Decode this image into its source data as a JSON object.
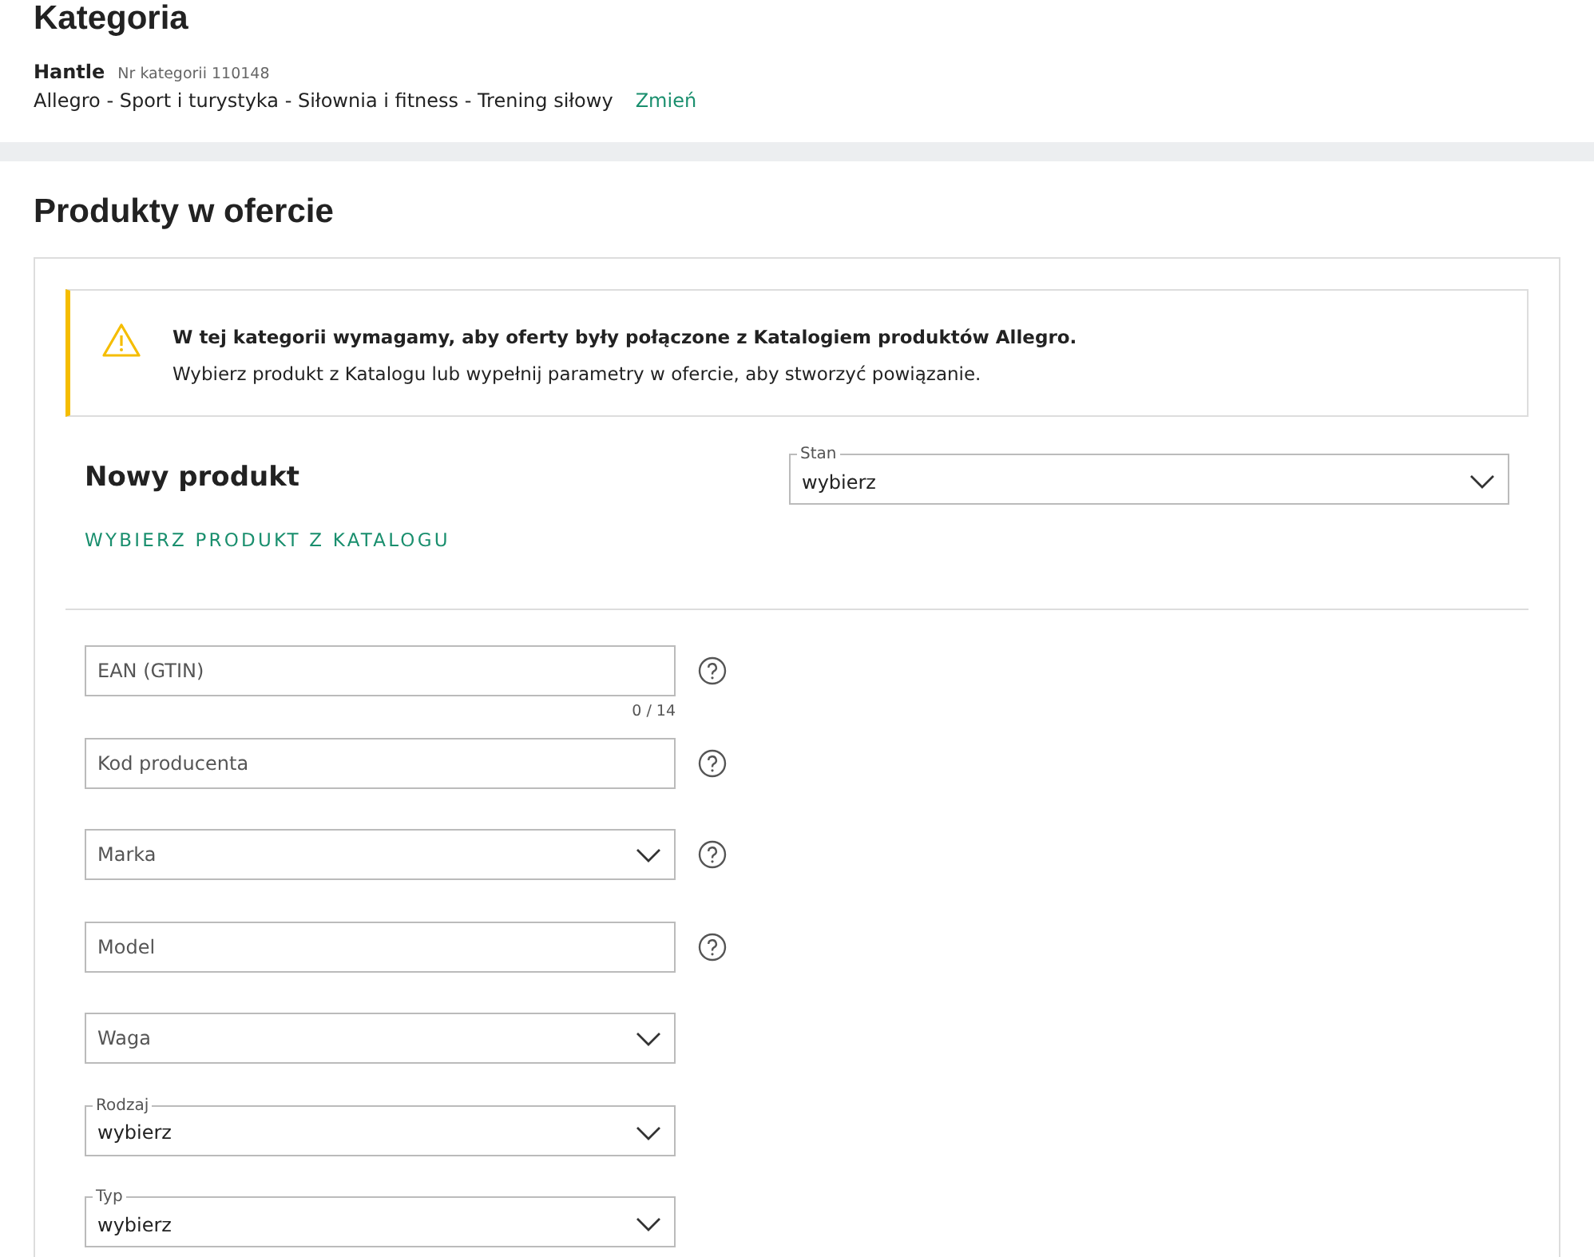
{
  "category": {
    "title": "Kategoria",
    "name": "Hantle",
    "number": "Nr kategorii 110148",
    "path": "Allegro - Sport i turystyka - Siłownia i fitness - Trening siłowy",
    "change_link": "Zmień"
  },
  "products": {
    "title": "Produkty w ofercie",
    "alert": {
      "title": "W tej kategorii wymagamy, aby oferty były połączone z Katalogiem produktów Allegro.",
      "text": "Wybierz produkt z Katalogu lub wypełnij parametry w ofercie, aby stworzyć powiązanie."
    },
    "new_product": {
      "title": "Nowy produkt",
      "catalog_link": "WYBIERZ PRODUKT Z KATALOGU",
      "condition": {
        "label": "Stan",
        "value": "wybierz"
      }
    },
    "fields": [
      {
        "kind": "text",
        "placeholder": "EAN (GTIN)",
        "help": true,
        "counter": "0 / 14"
      },
      {
        "kind": "text",
        "placeholder": "Kod producenta",
        "help": true
      },
      {
        "kind": "select",
        "placeholder": "Marka",
        "help": true
      },
      {
        "kind": "text",
        "placeholder": "Model",
        "help": true
      },
      {
        "kind": "select",
        "placeholder": "Waga",
        "help": false
      },
      {
        "kind": "labeled",
        "label": "Rodzaj",
        "value": "wybierz",
        "help": false
      },
      {
        "kind": "labeled",
        "label": "Typ",
        "value": "wybierz",
        "help": false
      }
    ]
  }
}
